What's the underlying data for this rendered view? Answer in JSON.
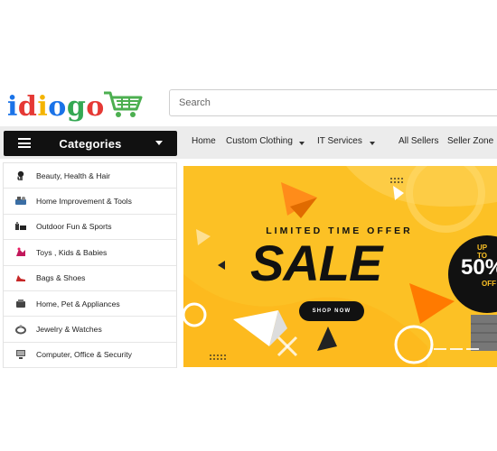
{
  "logo": {
    "letters": [
      "i",
      "d",
      "i",
      "o",
      "g",
      "o"
    ],
    "colors": [
      "#1a73e8",
      "#e53935",
      "#fbbc05",
      "#1a73e8",
      "#34a853",
      "#e53935"
    ],
    "cart_color": "#4caf50"
  },
  "search": {
    "placeholder": "Search"
  },
  "nav": {
    "categories_label": "Categories",
    "items": [
      {
        "label": "Home"
      },
      {
        "label": "Custom Clothing",
        "dropdown": true
      },
      {
        "label": "IT Services",
        "dropdown": true
      },
      {
        "label": "All Sellers"
      },
      {
        "label": "Seller Zone"
      }
    ]
  },
  "categories": [
    {
      "label": "Beauty, Health & Hair",
      "icon": "hair-icon"
    },
    {
      "label": "Home Improvement & Tools",
      "icon": "tools-icon"
    },
    {
      "label": "Outdoor Fun & Sports",
      "icon": "sports-icon"
    },
    {
      "label": "Toys , Kids & Babies",
      "icon": "toy-icon"
    },
    {
      "label": "Bags & Shoes",
      "icon": "shoe-icon"
    },
    {
      "label": "Home, Pet & Appliances",
      "icon": "appliance-icon"
    },
    {
      "label": "Jewelry & Watches",
      "icon": "jewelry-icon"
    },
    {
      "label": "Computer, Office & Security",
      "icon": "computer-icon"
    }
  ],
  "banner": {
    "subtitle": "LIMITED TIME OFFER",
    "headline": "SALE",
    "button": "SHOP NOW",
    "badge_top": "UP TO",
    "badge_value": "50%",
    "badge_bottom": "OFF",
    "bg_color": "#fcc125"
  }
}
